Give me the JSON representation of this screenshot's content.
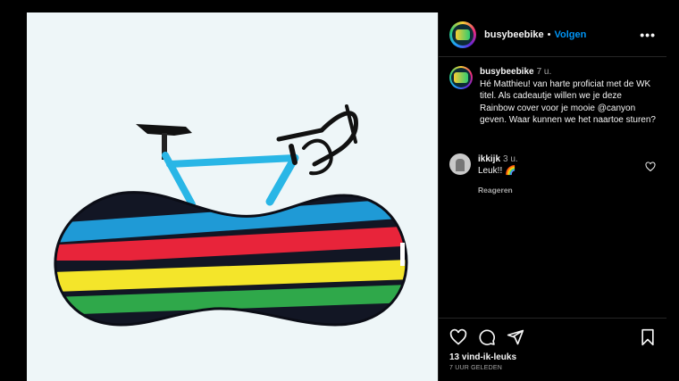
{
  "post": {
    "username": "busybeebike",
    "follow_label": "Volgen",
    "separator": "•",
    "more_label": "•••"
  },
  "caption": {
    "username": "busybeebike",
    "time": "7 u.",
    "text": "Hé Matthieu! van harte proficiat met de WK titel. Als cadeautje willen we je deze Rainbow cover voor je mooie @canyon geven. Waar kunnen we het naartoe sturen?"
  },
  "reply_comment": {
    "username": "ikkijk",
    "time": "3 u.",
    "text": "Leuk!! 🌈",
    "reply_label": "Reageren"
  },
  "footer": {
    "likes": "13 vind-ik-leuks",
    "posted": "7 UUR GELEDEN"
  },
  "icons": [
    "heart-icon",
    "comment-icon",
    "share-icon",
    "bookmark-icon",
    "more-options-icon"
  ],
  "colors": {
    "follow": "#0095f6",
    "stripe_blue": "#1f9ad6",
    "stripe_red": "#e8243a",
    "stripe_yellow": "#f4e52a",
    "stripe_green": "#2fa84a",
    "frame_blue": "#29b6e6"
  }
}
